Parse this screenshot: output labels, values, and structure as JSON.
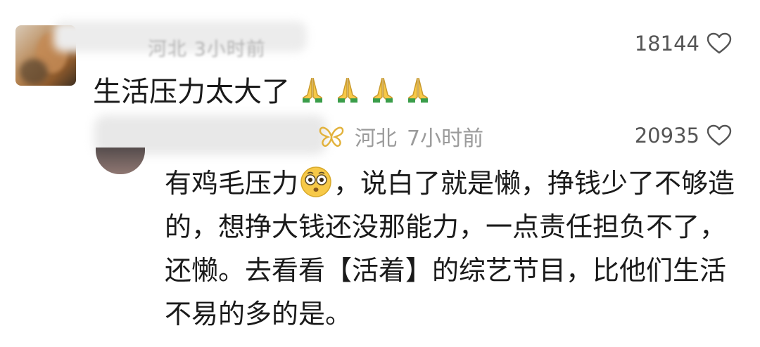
{
  "comments": [
    {
      "meta": "河北 3小时前",
      "likes": "18144",
      "text": "生活压力太大了",
      "emojis": [
        "folded-hands",
        "folded-hands",
        "folded-hands",
        "folded-hands"
      ]
    },
    {
      "region": "河北",
      "time": "7小时前",
      "likes": "20935",
      "text_part1": "有鸡毛压力",
      "text_part2": "，说白了就是懒，挣钱少了不够造的，想挣大钱还没那能力，一点责任担负不了，还懒。去看看【活着】的综艺节目，比他们生活不易的多的是。",
      "emoji": "flushed-face"
    }
  ],
  "colors": {
    "text": "#1a1a1a",
    "meta": "#9b9b9b",
    "likes": "#555555",
    "emoji_yellow": "#f7c948",
    "pray_green": "#3a9d4a"
  }
}
